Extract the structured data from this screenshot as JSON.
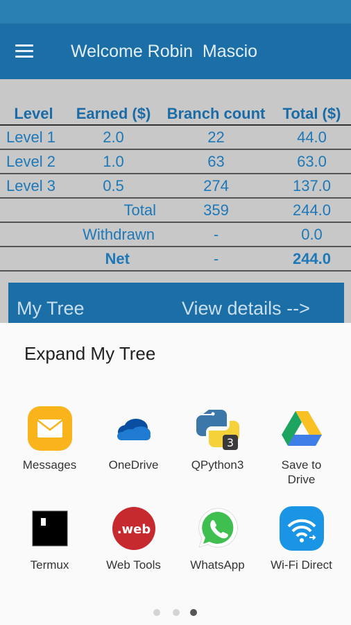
{
  "header": {
    "title": "Welcome Robin  Mascio"
  },
  "table": {
    "columns": [
      "Level",
      "Earned ($)",
      "Branch count",
      "Total ($)"
    ],
    "rows": [
      {
        "level": "Level 1",
        "earned": "2.0",
        "branch": "22",
        "total": "44.0"
      },
      {
        "level": "Level 2",
        "earned": "1.0",
        "branch": "63",
        "total": "63.0"
      },
      {
        "level": "Level 3",
        "earned": "0.5",
        "branch": "274",
        "total": "137.0"
      }
    ],
    "summary": {
      "total_label": "Total",
      "total_branch": "359",
      "total_value": "244.0",
      "withdrawn_label": "Withdrawn",
      "withdrawn_branch": "-",
      "withdrawn_value": "0.0",
      "net_label": "Net",
      "net_branch": "-",
      "net_value": "244.0"
    }
  },
  "tree": {
    "label": "My Tree",
    "details": "View details -->"
  },
  "share_sheet": {
    "title": "Expand My Tree",
    "apps": [
      {
        "name": "Messages",
        "icon": "messages-icon"
      },
      {
        "name": "OneDrive",
        "icon": "onedrive-icon"
      },
      {
        "name": "QPython3",
        "icon": "qpython-icon"
      },
      {
        "name": "Save to\nDrive",
        "icon": "google-drive-icon"
      },
      {
        "name": "Termux",
        "icon": "termux-icon"
      },
      {
        "name": "Web Tools",
        "icon": "web-tools-icon"
      },
      {
        "name": "WhatsApp",
        "icon": "whatsapp-icon"
      },
      {
        "name": "Wi-Fi Direct",
        "icon": "wifi-direct-icon"
      }
    ],
    "pages": 3,
    "current_page": 3
  },
  "colors": {
    "primary": "#1b6fa6",
    "status_bar": "#2a7fb3",
    "table_text": "#1e78b8",
    "background": "#c8c8c8"
  }
}
